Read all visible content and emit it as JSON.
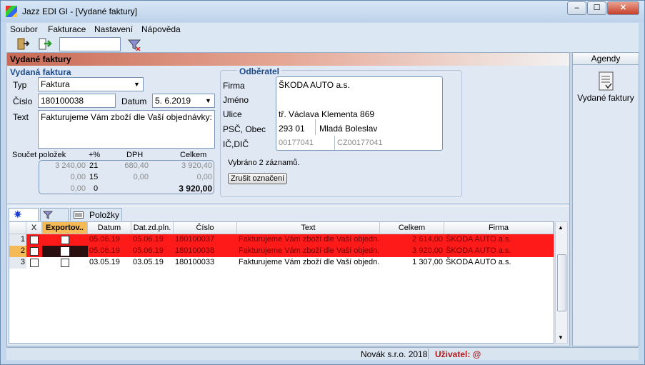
{
  "window": {
    "title": "Jazz EDI GI - [Vydané faktury]",
    "min": "–",
    "max": "☐",
    "close": "✕"
  },
  "menu": [
    {
      "label": "Soubor"
    },
    {
      "label": "Fakturace"
    },
    {
      "label": "Nastavení"
    },
    {
      "label": "Nápověda"
    }
  ],
  "toolbar": {
    "search_value": ""
  },
  "panel": {
    "header": "Vydané faktury"
  },
  "invoice": {
    "group": "Vydaná faktura",
    "type_label": "Typ",
    "type_value": "Faktura",
    "number_label": "Číslo",
    "number_value": "180100038",
    "date_label": "Datum",
    "date_value": "5. 6.2019",
    "text_label": "Text",
    "text_value": "Fakturujeme Vám zboží dle Vaší objednávky:"
  },
  "sum": {
    "label": "Součet položek",
    "h_pct": "+%",
    "h_dph": "DPH",
    "h_total": "Celkem",
    "rows": [
      {
        "base": "3 240,00",
        "pct": "21",
        "dph": "680,40",
        "total": "3 920,40"
      },
      {
        "base": "0,00",
        "pct": "15",
        "dph": "0,00",
        "total": "0,00"
      },
      {
        "base": "0,00",
        "pct": "0",
        "dph": "",
        "total": "3 920,00"
      }
    ]
  },
  "customer": {
    "group": "Odběratel",
    "firm_label": "Firma",
    "firm_value": "ŠKODA AUTO a.s.",
    "name_label": "Jméno",
    "name_value": "",
    "street_label": "Ulice",
    "street_value": "tř. Václava Klementa 869",
    "zip_label": "PSČ, Obec",
    "zip_value": "293 01",
    "city_value": "Mladá Boleslav",
    "ic_label": "IČ,DIČ",
    "ic_value": "00177041",
    "dic_value": "CZ00177041"
  },
  "selection": {
    "text": "Vybráno 2 záznamů.",
    "clear_button": "Zrušit označení"
  },
  "tabs": {
    "items_label": "Položky"
  },
  "grid": {
    "headers": [
      "X",
      "Exportov..",
      "Datum",
      "Dat.zd.pln.",
      "Číslo",
      "Text",
      "Celkem",
      "Firma"
    ],
    "rows": [
      {
        "n": "1",
        "date": "05.06.19",
        "taxdate": "05.06.19",
        "number": "180100037",
        "text": "Fakturujeme Vám zboží dle Vaší objedn...",
        "total": "2 614,00",
        "firm": "ŠKODA AUTO a.s."
      },
      {
        "n": "2",
        "date": "05.06.19",
        "taxdate": "05.06.19",
        "number": "180100038",
        "text": "Fakturujeme Vám zboží dle Vaší objedn...",
        "total": "3 920,00",
        "firm": "ŠKODA AUTO a.s."
      },
      {
        "n": "3",
        "date": "03.05.19",
        "taxdate": "03.05.19",
        "number": "180100033",
        "text": "Fakturujeme Vám zboží dle Vaší objedn...",
        "total": "1 307,00",
        "firm": "ŠKODA AUTO a.s."
      }
    ]
  },
  "status": {
    "company": "Novák s.r.o. 2018",
    "user_label": "Uživatel: @"
  },
  "sidebar": {
    "header": "Agendy",
    "item": "Vydané faktury"
  },
  "colors": {
    "selected_row": "#ff1a1a",
    "header_accent": "#c86a55",
    "group_title": "#1c4a8c"
  }
}
